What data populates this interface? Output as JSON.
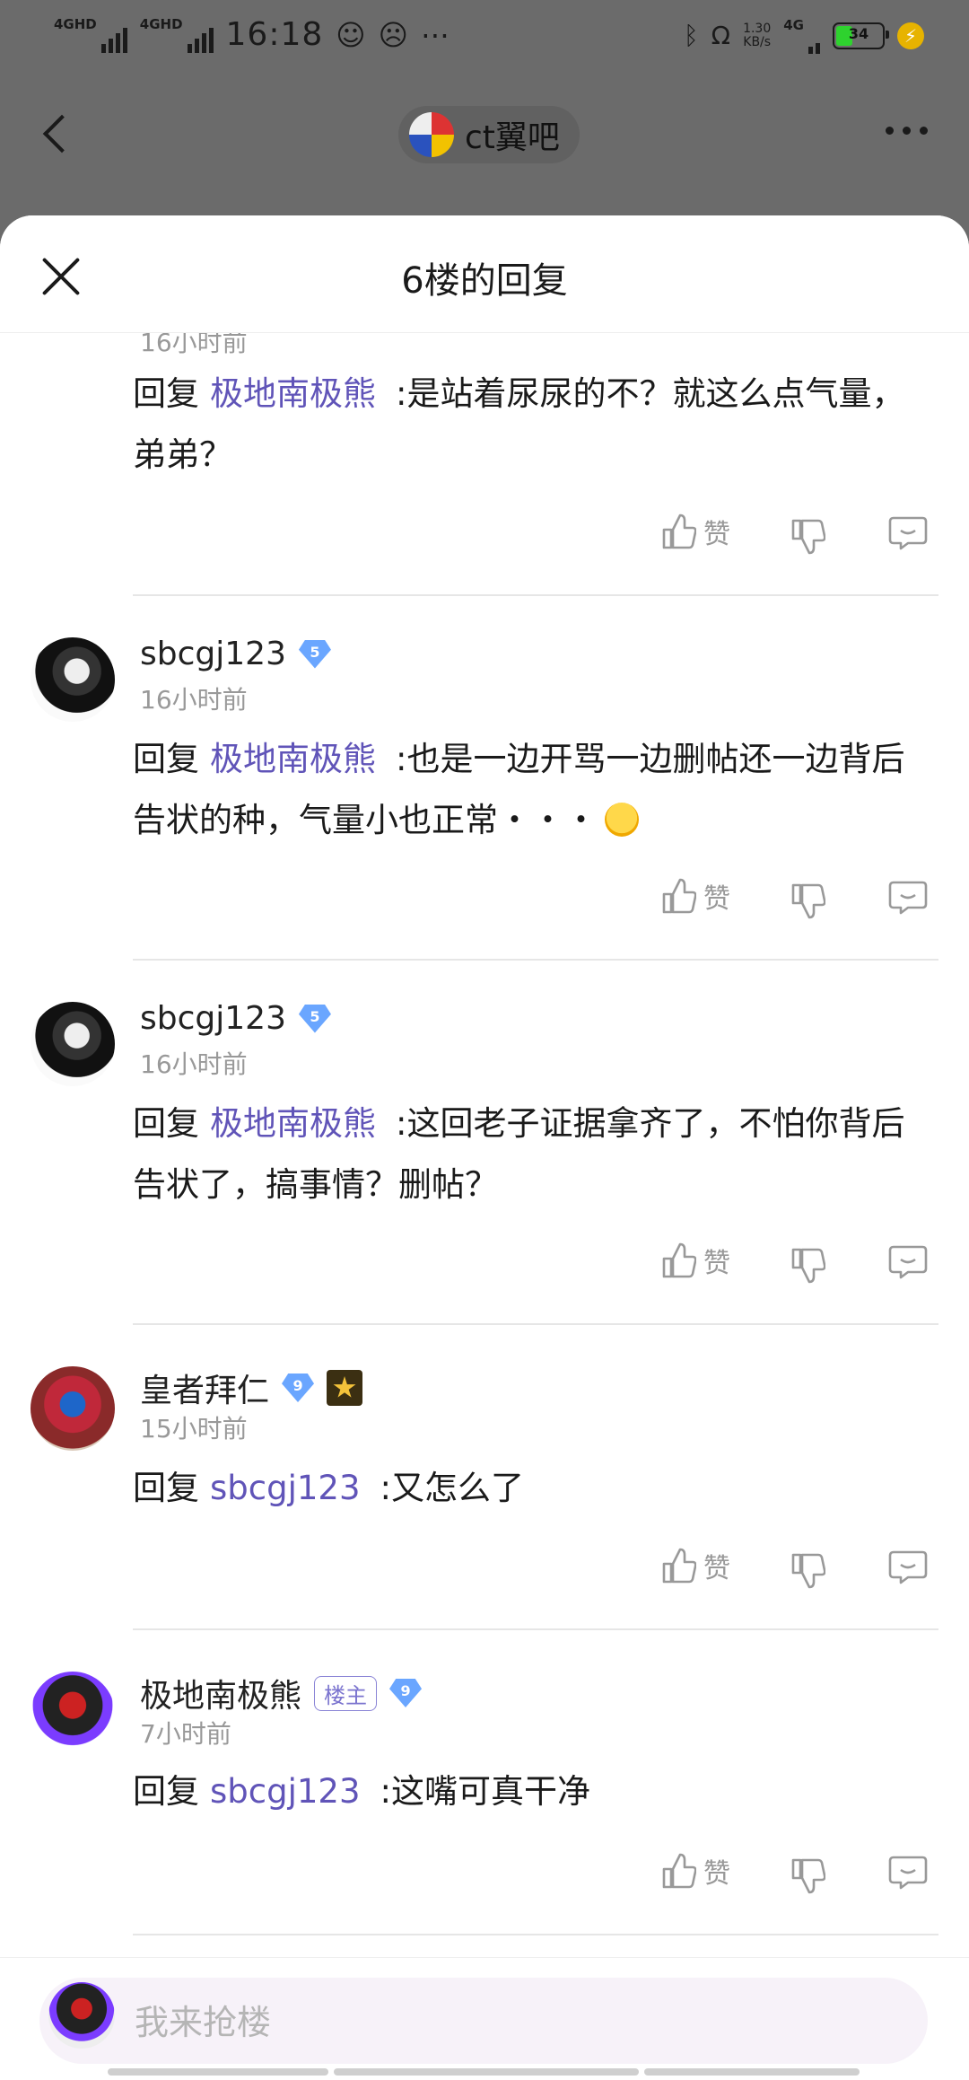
{
  "status_bar": {
    "network_1": "4GHD",
    "network_2": "4GHD",
    "time": "16:18",
    "icon_names": [
      "signal-icon",
      "signal-icon",
      "person-icon",
      "chat-icon",
      "more-dots-icon",
      "bluetooth-icon",
      "headphones-icon",
      "bolt-icon"
    ],
    "speed_value": "1.30",
    "speed_unit": "KB/s",
    "network_3": "4G",
    "battery": "34",
    "battery_level": 0.34
  },
  "nav": {
    "forum_name": "ct翼吧"
  },
  "sheet": {
    "title": "6楼的回复"
  },
  "replies": [
    {
      "time": "16小时前",
      "prefix": "回复",
      "mention": "极地南极熊",
      "text": ":是站着尿尿的不？就这么点气量，弟弟？",
      "like_label": "赞"
    },
    {
      "username": "sbcgj123",
      "level": "5",
      "time": "16小时前",
      "prefix": "回复",
      "mention": "极地南极熊",
      "text": ":也是一边开骂一边删帖还一边背后告状的种，气量小也正常・・・",
      "emoji": "angry-face-emoji",
      "like_label": "赞"
    },
    {
      "username": "sbcgj123",
      "level": "5",
      "time": "16小时前",
      "prefix": "回复",
      "mention": "极地南极熊",
      "text": ":这回老子证据拿齐了，不怕你背后告状了，搞事情？删帖？",
      "like_label": "赞"
    },
    {
      "username": "皇者拜仁",
      "level": "9",
      "time": "15小时前",
      "prefix": "回复",
      "mention": "sbcgj123",
      "text": ":又怎么了",
      "like_label": "赞"
    },
    {
      "username": "极地南极熊",
      "owner_tag": "楼主",
      "level": "9",
      "time": "7小时前",
      "prefix": "回复",
      "mention": "sbcgj123",
      "text": ":这嘴可真干净",
      "like_label": "赞"
    }
  ],
  "input": {
    "placeholder": "我来抢楼"
  },
  "colors": {
    "mention": "#6054b8",
    "meta_text": "#999999",
    "level_badge": "#6aa6ff",
    "owner_tag": "#7b74cf",
    "input_bg": "#f7f2f9"
  }
}
